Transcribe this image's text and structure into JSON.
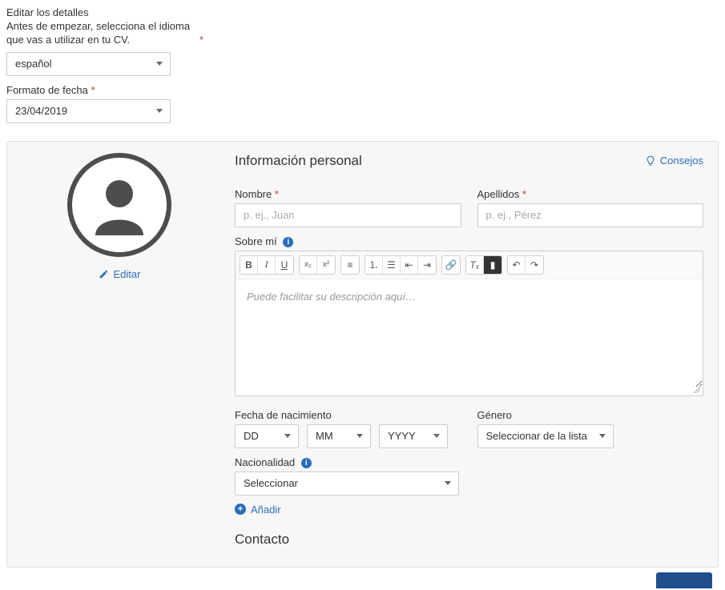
{
  "header": {
    "title": "Editar los detalles",
    "instruction": "Antes de empezar, selecciona el idioma que vas a utilizar en tu CV."
  },
  "language": {
    "value": "español"
  },
  "date_format": {
    "label": "Formato de fecha",
    "value": "23/04/2019"
  },
  "avatar": {
    "edit": "Editar"
  },
  "personal": {
    "heading": "Información personal",
    "tips": "Consejos",
    "first_name": {
      "label": "Nombre",
      "placeholder": "p. ej., Juan"
    },
    "last_name": {
      "label": "Apellidos",
      "placeholder": "p. ej., Pérez"
    },
    "about": {
      "label": "Sobre mí",
      "placeholder": "Puede facilitar su descripción aquí…"
    },
    "dob": {
      "label": "Fecha de nacimiento",
      "day": "DD",
      "month": "MM",
      "year": "YYYY"
    },
    "gender": {
      "label": "Género",
      "placeholder": "Seleccionar de la lista"
    },
    "nationality": {
      "label": "Nacionalidad",
      "placeholder": "Seleccionar",
      "add": "Añadir"
    }
  },
  "contact": {
    "heading": "Contacto"
  },
  "toolbar_icons": {
    "bold": "B",
    "italic": "I",
    "underline": "U",
    "sub": "x₂",
    "sup": "x²",
    "align": "≡",
    "ol": "⒈",
    "ul": "☰",
    "outdent": "⇤",
    "indent": "⇥",
    "link": "🔗",
    "clear": "Tₓ",
    "paste": "▮",
    "undo": "↶",
    "redo": "↷"
  }
}
